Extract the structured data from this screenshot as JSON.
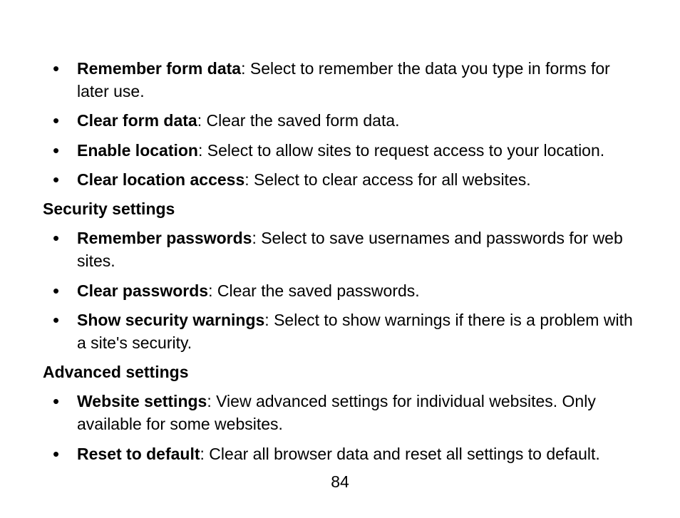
{
  "items1": [
    {
      "term": "Remember form data",
      "desc": ": Select to remember the data you type in forms for later use."
    },
    {
      "term": "Clear form data",
      "desc": ": Clear the saved form data."
    },
    {
      "term": "Enable location",
      "desc": ": Select to allow sites to request access to your location."
    },
    {
      "term": "Clear location access",
      "desc": ": Select to clear access for all websites."
    }
  ],
  "heading1": "Security settings",
  "items2": [
    {
      "term": "Remember passwords",
      "desc": ": Select to save usernames and passwords for web sites."
    },
    {
      "term": "Clear passwords",
      "desc": ": Clear the saved passwords."
    },
    {
      "term": "Show security warnings",
      "desc": ": Select to show warnings if there is a problem with a site's security."
    }
  ],
  "heading2": "Advanced settings",
  "items3": [
    {
      "term": "Website settings",
      "desc": ": View advanced settings for individual websites. Only available for some websites."
    },
    {
      "term": "Reset to default",
      "desc": ": Clear all browser data and reset all settings to default."
    }
  ],
  "pageNumber": "84"
}
